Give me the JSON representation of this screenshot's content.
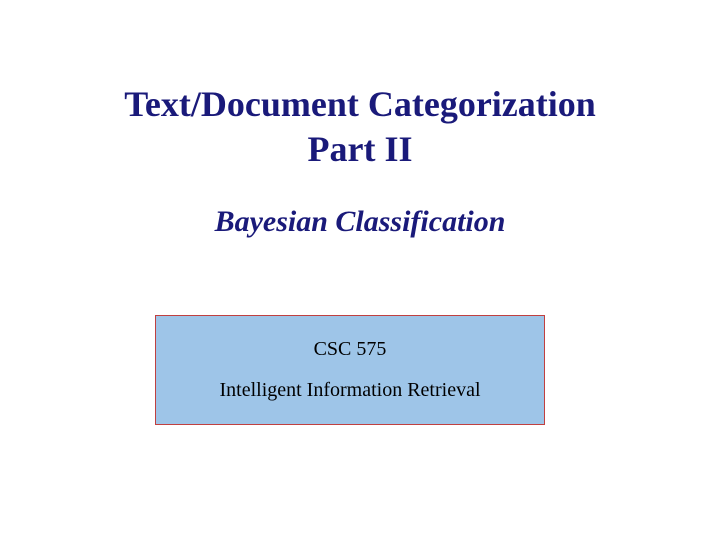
{
  "slide": {
    "title_line1": "Text/Document Categorization",
    "title_line2": "Part II",
    "subtitle": "Bayesian Classification",
    "box": {
      "course_code": "CSC 575",
      "course_name": "Intelligent Information Retrieval"
    }
  }
}
